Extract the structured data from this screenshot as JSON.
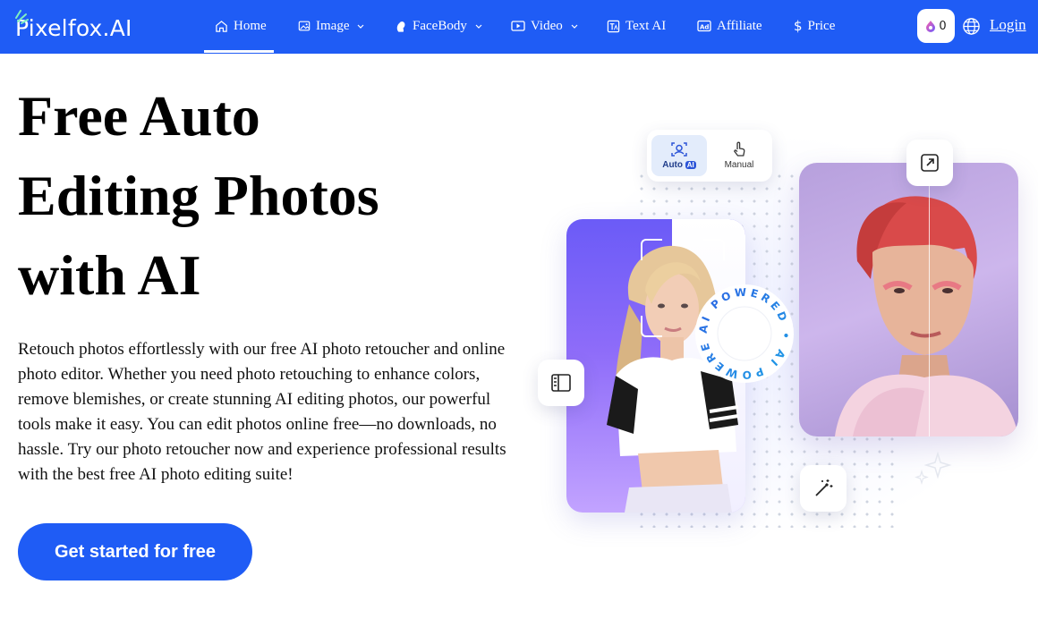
{
  "nav": {
    "logo": "Pixelfox.AI",
    "items": [
      {
        "label": "Home",
        "icon": "home-icon"
      },
      {
        "label": "Image",
        "icon": "image-icon"
      },
      {
        "label": "FaceBody",
        "icon": "face-body-icon"
      },
      {
        "label": "Video",
        "icon": "video-icon"
      },
      {
        "label": "Text AI",
        "icon": "text-ai-icon"
      },
      {
        "label": "Affiliate",
        "icon": "affiliate-icon"
      },
      {
        "label": "Price",
        "icon": "dollar-icon"
      }
    ],
    "active": "Home",
    "credits": "0",
    "login": "Login"
  },
  "hero": {
    "title": "Free Auto Editing Photos with AI",
    "title_lines": [
      "Free Auto",
      "Editing Photos",
      "with AI"
    ],
    "description": "Retouch photos effortlessly with our free AI photo retoucher and online photo editor. Whether you need photo retouching to enhance colors, remove blemishes, or create stunning AI editing photos, our powerful tools make it easy. You can edit photos online free—no downloads, no hassle. Try our photo retoucher now and experience professional results with the best free AI photo editing suite!",
    "cta": "Get started for free"
  },
  "illustration": {
    "toggle": {
      "auto_label": "Auto",
      "ai_chip": "AI",
      "manual_label": "Manual"
    },
    "badge_text": "AI POWERED • AI POWERED •",
    "accent": "#1f5cf5"
  }
}
